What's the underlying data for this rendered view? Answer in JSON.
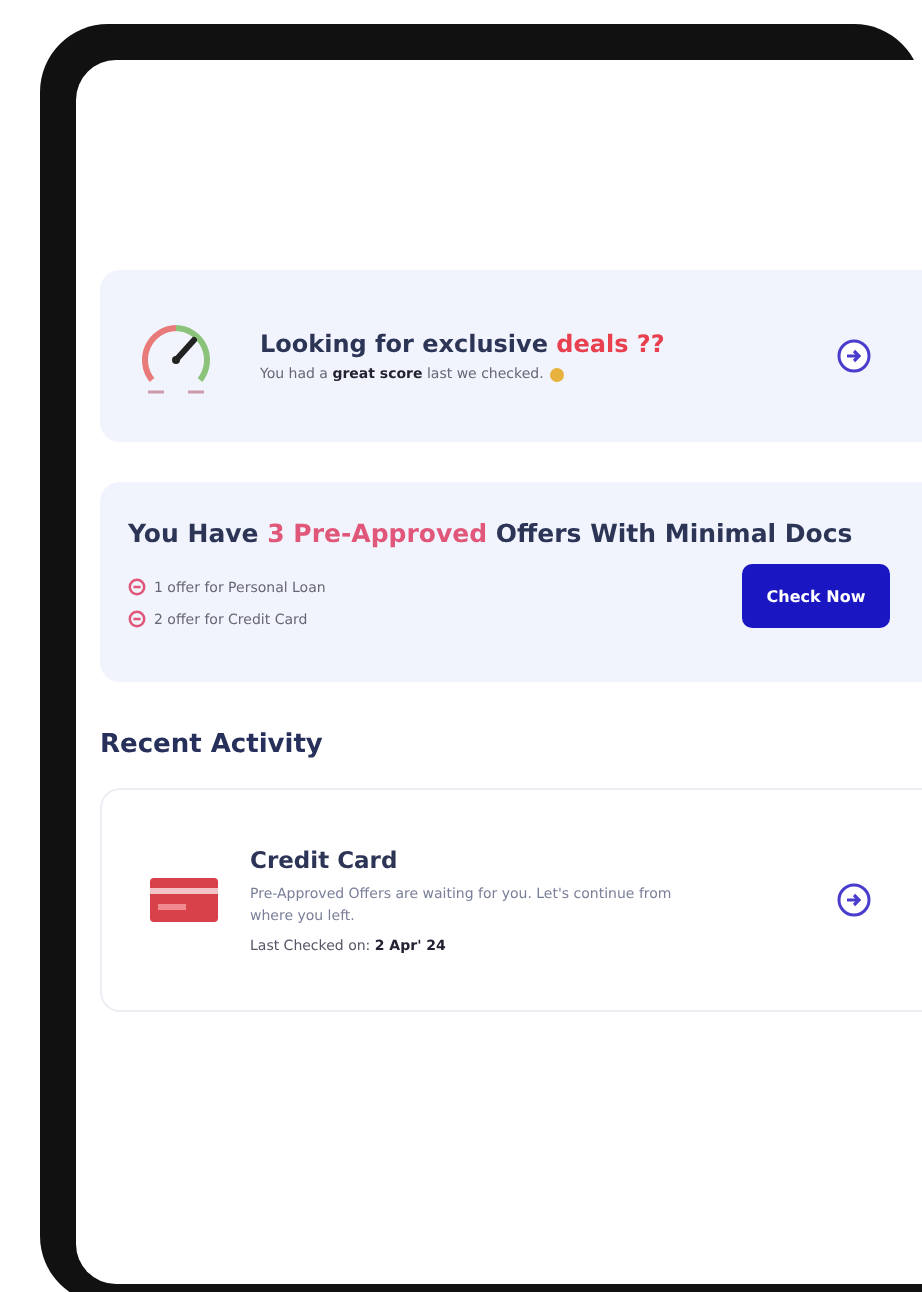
{
  "deals_card": {
    "title": [
      {
        "text": "Looking for exclusive ",
        "highlight": false
      },
      {
        "text": "deals ??",
        "highlight": true
      }
    ],
    "subtitle": "You had a **great score** last we checked."
  },
  "offers_card": {
    "title": [
      {
        "text": "You Have ",
        "highlight": false
      },
      {
        "text": "3 Pre-Approved",
        "highlight": true
      },
      {
        "text": " Offers With Minimal Docs",
        "highlight": false
      }
    ],
    "items": [
      "1 offer for Personal Loan",
      "2 offer for Credit Card"
    ],
    "button": "Check Now"
  },
  "recent_activity": {
    "heading": "Recent Activity",
    "items": [
      {
        "title": "Credit Card",
        "description": "Pre-Approved Offers are waiting for you. Let's continue from where you left.",
        "last_checked": "Last Checked on: **2 Apr' 24**"
      }
    ]
  }
}
